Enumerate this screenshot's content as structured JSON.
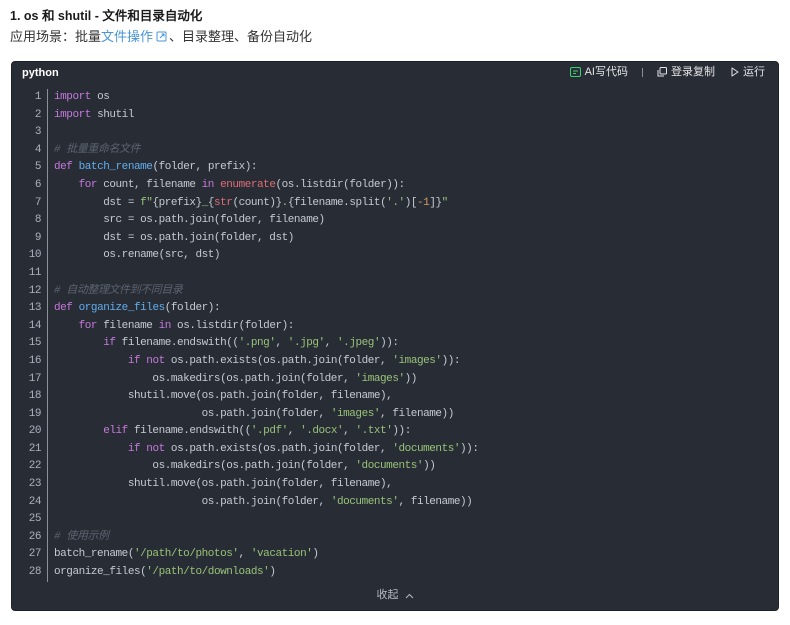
{
  "heading": "1. os 和 shutil - 文件和目录自动化",
  "scene": {
    "prefix": "应用场景：批量",
    "link_text": "文件操作",
    "link_icon": "external-link-icon",
    "suffix": "、目录整理、备份自动化"
  },
  "code_block": {
    "language": "python",
    "toolbar": {
      "ai": {
        "label": "AI写代码",
        "icon": "ai-code-icon"
      },
      "copy": {
        "label": "登录复制",
        "icon": "copy-icon"
      },
      "run": {
        "label": "运行",
        "icon": "play-icon"
      }
    },
    "lines": [
      {
        "n": 1,
        "tokens": [
          {
            "kw": "import"
          },
          {
            "p": " os"
          }
        ]
      },
      {
        "n": 2,
        "tokens": [
          {
            "kw": "import"
          },
          {
            "p": " shutil"
          }
        ]
      },
      {
        "n": 3,
        "tokens": []
      },
      {
        "n": 4,
        "tokens": [
          {
            "cm": "# 批量重命名文件"
          }
        ]
      },
      {
        "n": 5,
        "tokens": [
          {
            "kw": "def"
          },
          {
            "p": " "
          },
          {
            "fn": "batch_rename"
          },
          {
            "p": "(folder, prefix):"
          }
        ]
      },
      {
        "n": 6,
        "tokens": [
          {
            "p": "    "
          },
          {
            "kw": "for"
          },
          {
            "p": " count, filename "
          },
          {
            "kw": "in"
          },
          {
            "p": " "
          },
          {
            "bi": "enumerate"
          },
          {
            "p": "(os.listdir(folder)):"
          }
        ]
      },
      {
        "n": 7,
        "tokens": [
          {
            "p": "        dst = "
          },
          {
            "str": "f\""
          },
          {
            "p": "{prefix}"
          },
          {
            "str": "_"
          },
          {
            "p": "{"
          },
          {
            "bi": "str"
          },
          {
            "p": "(count)}"
          },
          {
            "str": "."
          },
          {
            "p": "{filename.split("
          },
          {
            "str": "'.'"
          },
          {
            "p": ")["
          },
          {
            "num": "-1"
          },
          {
            "p": "]}"
          },
          {
            "str": "\""
          }
        ]
      },
      {
        "n": 8,
        "tokens": [
          {
            "p": "        src = os.path.join(folder, filename)"
          }
        ]
      },
      {
        "n": 9,
        "tokens": [
          {
            "p": "        dst = os.path.join(folder, dst)"
          }
        ]
      },
      {
        "n": 10,
        "tokens": [
          {
            "p": "        os.rename(src, dst)"
          }
        ]
      },
      {
        "n": 11,
        "tokens": []
      },
      {
        "n": 12,
        "tokens": [
          {
            "cm": "# 自动整理文件到不同目录"
          }
        ]
      },
      {
        "n": 13,
        "tokens": [
          {
            "kw": "def"
          },
          {
            "p": " "
          },
          {
            "fn": "organize_files"
          },
          {
            "p": "(folder):"
          }
        ]
      },
      {
        "n": 14,
        "tokens": [
          {
            "p": "    "
          },
          {
            "kw": "for"
          },
          {
            "p": " filename "
          },
          {
            "kw": "in"
          },
          {
            "p": " os.listdir(folder):"
          }
        ]
      },
      {
        "n": 15,
        "tokens": [
          {
            "p": "        "
          },
          {
            "kw": "if"
          },
          {
            "p": " filename.endswith(("
          },
          {
            "str": "'.png'"
          },
          {
            "p": ", "
          },
          {
            "str": "'.jpg'"
          },
          {
            "p": ", "
          },
          {
            "str": "'.jpeg'"
          },
          {
            "p": ")):"
          }
        ]
      },
      {
        "n": 16,
        "tokens": [
          {
            "p": "            "
          },
          {
            "kw": "if"
          },
          {
            "p": " "
          },
          {
            "kw": "not"
          },
          {
            "p": " os.path.exists(os.path.join(folder, "
          },
          {
            "str": "'images'"
          },
          {
            "p": ")):"
          }
        ]
      },
      {
        "n": 17,
        "tokens": [
          {
            "p": "                os.makedirs(os.path.join(folder, "
          },
          {
            "str": "'images'"
          },
          {
            "p": "))"
          }
        ]
      },
      {
        "n": 18,
        "tokens": [
          {
            "p": "            shutil.move(os.path.join(folder, filename),"
          }
        ]
      },
      {
        "n": 19,
        "tokens": [
          {
            "p": "                        os.path.join(folder, "
          },
          {
            "str": "'images'"
          },
          {
            "p": ", filename))"
          }
        ]
      },
      {
        "n": 20,
        "tokens": [
          {
            "p": "        "
          },
          {
            "kw": "elif"
          },
          {
            "p": " filename.endswith(("
          },
          {
            "str": "'.pdf'"
          },
          {
            "p": ", "
          },
          {
            "str": "'.docx'"
          },
          {
            "p": ", "
          },
          {
            "str": "'.txt'"
          },
          {
            "p": ")):"
          }
        ]
      },
      {
        "n": 21,
        "tokens": [
          {
            "p": "            "
          },
          {
            "kw": "if"
          },
          {
            "p": " "
          },
          {
            "kw": "not"
          },
          {
            "p": " os.path.exists(os.path.join(folder, "
          },
          {
            "str": "'documents'"
          },
          {
            "p": ")):"
          }
        ]
      },
      {
        "n": 22,
        "tokens": [
          {
            "p": "                os.makedirs(os.path.join(folder, "
          },
          {
            "str": "'documents'"
          },
          {
            "p": "))"
          }
        ]
      },
      {
        "n": 23,
        "tokens": [
          {
            "p": "            shutil.move(os.path.join(folder, filename),"
          }
        ]
      },
      {
        "n": 24,
        "tokens": [
          {
            "p": "                        os.path.join(folder, "
          },
          {
            "str": "'documents'"
          },
          {
            "p": ", filename))"
          }
        ]
      },
      {
        "n": 25,
        "tokens": []
      },
      {
        "n": 26,
        "tokens": [
          {
            "cm": "# 使用示例"
          }
        ]
      },
      {
        "n": 27,
        "tokens": [
          {
            "p": "batch_rename("
          },
          {
            "str": "'/path/to/photos'"
          },
          {
            "p": ", "
          },
          {
            "str": "'vacation'"
          },
          {
            "p": ")"
          }
        ]
      },
      {
        "n": 28,
        "tokens": [
          {
            "p": "organize_files("
          },
          {
            "str": "'/path/to/downloads'"
          },
          {
            "p": ")"
          }
        ]
      }
    ],
    "collapse": {
      "label": "收起",
      "icon": "chevron-up-icon"
    }
  },
  "theme": {
    "link": "#4a94d8",
    "code_bg": "#282c34",
    "plain": "#c5cad3",
    "keyword": "#c678dd",
    "function": "#61aeee",
    "builtin": "#e06c75",
    "string": "#98c379",
    "number": "#d19a66",
    "comment": "#5c6370",
    "line_number": "#abb2bf",
    "ai_icon": "#3ccf6f"
  }
}
